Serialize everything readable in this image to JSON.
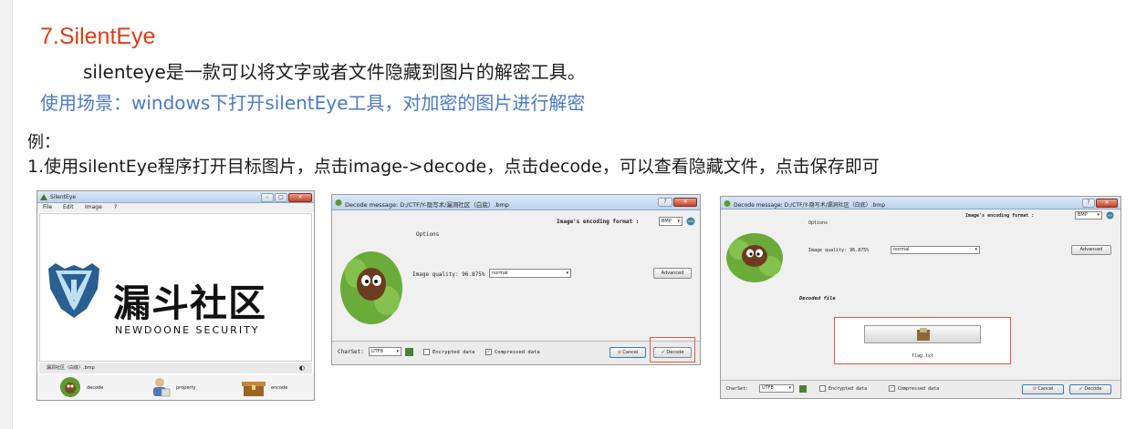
{
  "slide": {
    "title": "7.SilentEye",
    "line1": "silenteye是一款可以将文字或者文件隐藏到图片的解密工具。",
    "line2": "使用场景：windows下打开silentEye工具，对加密的图片进行解密",
    "line3": "例：",
    "line4": "1.使用silentEye程序打开目标图片，点击image->decode，点击decode，可以查看隐藏文件，点击保存即可"
  },
  "screenshot1": {
    "window_title": "SilentEye",
    "menu": [
      "File",
      "Edit",
      "Image",
      "?"
    ],
    "logo_cn": "漏斗社区",
    "logo_en": "NEWDOONE SECURITY",
    "file_label": "漏洞社区（白底）.bmp",
    "actions": [
      {
        "icon": "decode-icon",
        "label": "decode"
      },
      {
        "icon": "property-icon",
        "label": "property"
      },
      {
        "icon": "encode-icon",
        "label": "encode"
      }
    ]
  },
  "screenshot2": {
    "window_title": "Decode message: D:/CTF/Y-隐写术/漏洞社区（白底）.bmp",
    "encoding_label": "Image's encoding format :",
    "encoding_value": "BMP",
    "options_label": "Options",
    "quality_label": "Image quality:",
    "quality_value": "96.875%",
    "quality_select": "normal",
    "advanced_button": "Advanced",
    "charset_label": "CharSet:",
    "charset_value": "UTF8",
    "encrypted_label": "Encrypted data",
    "compressed_label": "Compressed data",
    "cancel_button": "Cancel",
    "decode_button": "Decode"
  },
  "screenshot3": {
    "window_title": "Decode message: D:/CTF/Y-隐写术/漏洞社区（白底）.bmp",
    "encoding_label": "Image's encoding format :",
    "encoding_value": "BMP",
    "options_label": "Options",
    "quality_label": "Image quality:",
    "quality_value": "96.875%",
    "quality_select": "normal",
    "advanced_button": "Advanced",
    "decoded_label": "Decoded file",
    "file_name": "flag.txt",
    "charset_label": "CharSet:",
    "charset_value": "UTF8",
    "encrypted_label": "Encrypted data",
    "compressed_label": "Compressed data",
    "cancel_button": "Cancel",
    "decode_button": "Decode"
  },
  "colors": {
    "title_red": "#e23b12",
    "subtitle_blue": "#4a7ac8",
    "highlight_red": "#e35a4a",
    "titlebar_blue": "#bcd2ec"
  }
}
